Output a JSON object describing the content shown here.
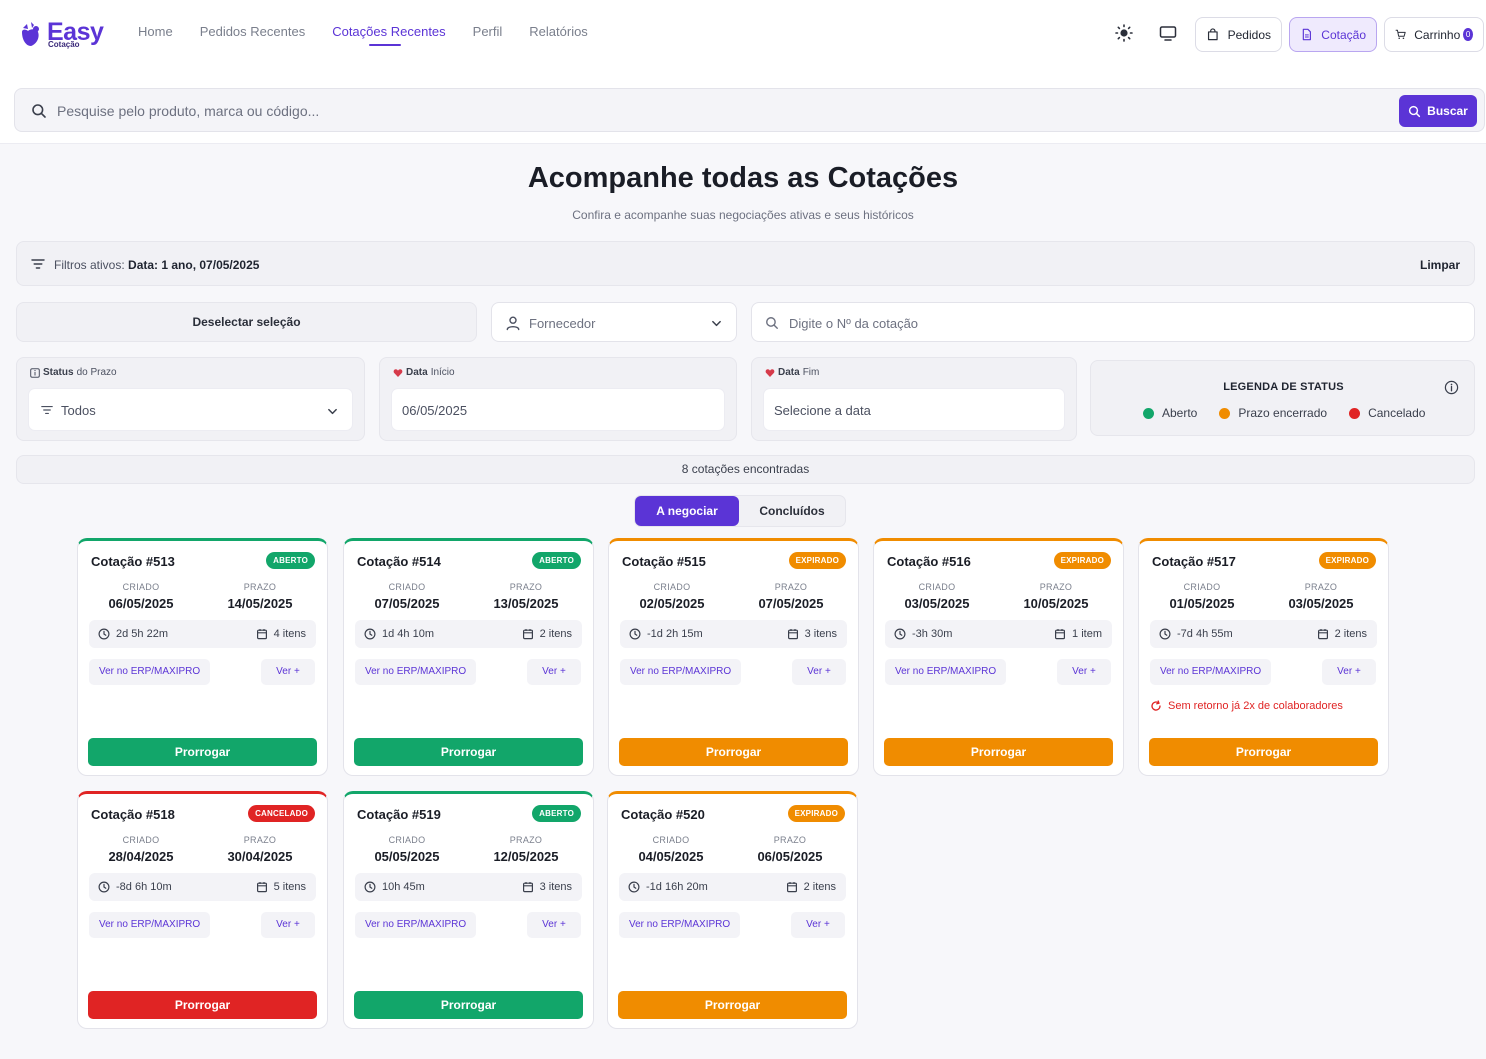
{
  "header": {
    "logo_text": "Easy",
    "logo_sub": "Cotação",
    "nav": [
      "Home",
      "Pedidos Recentes",
      "Cotações Recentes",
      "Perfil",
      "Relatórios"
    ],
    "active_nav": "Cotações Recentes",
    "pedidos_label": "Pedidos",
    "cotacao_label": "Cotação",
    "carrinho_label": "Carrinho",
    "cart_count": "0"
  },
  "search": {
    "placeholder": "Pesquise pelo produto, marca ou código...",
    "button_label": "Buscar"
  },
  "page": {
    "title": "Acompanhe todas as Cotações",
    "subtitle": "Confira e acompanhe suas negociações ativas e seus históricos"
  },
  "filters": {
    "active_prefix": "Filtros ativos:",
    "active_value": "Data: 1 ano, 07/05/2025",
    "clear_label": "Limpar",
    "deselect_label": "Deselectar seleção",
    "supplier_placeholder": "Fornecedor",
    "quote_no_placeholder": "Digite o Nº da cotação",
    "status_label_bold": "Status",
    "status_label_rest": "do Prazo",
    "status_value": "Todos",
    "start_label_bold": "Data",
    "start_label_rest": "Início",
    "start_value": "06/05/2025",
    "end_label_bold": "Data",
    "end_label_rest": "Fim",
    "end_placeholder": "Selecione a data"
  },
  "legend": {
    "title": "LEGENDA DE STATUS",
    "items": [
      {
        "label": "Aberto",
        "color": "#12a66a"
      },
      {
        "label": "Prazo encerrado",
        "color": "#f08c00"
      },
      {
        "label": "Cancelado",
        "color": "#e02424"
      }
    ]
  },
  "results": {
    "count_text": "8 cotações encontradas"
  },
  "tabs": [
    "A negociar",
    "Concluídos"
  ],
  "card_labels": {
    "created": "CRIADO",
    "deadline": "PRAZO",
    "erp_link": "Ver no ERP/MAXIPRO",
    "more": "Ver +",
    "action": "Prorrogar"
  },
  "cards": [
    {
      "title": "Cotação #513",
      "badge": "ABERTO",
      "created": "06/05/2025",
      "deadline": "14/05/2025",
      "time": "2d 5h 22m",
      "items": "4 itens",
      "warning": ""
    },
    {
      "title": "Cotação #514",
      "badge": "ABERTO",
      "created": "07/05/2025",
      "deadline": "13/05/2025",
      "time": "1d 4h 10m",
      "items": "2 itens",
      "warning": ""
    },
    {
      "title": "Cotação #515",
      "badge": "EXPIRADO",
      "created": "02/05/2025",
      "deadline": "07/05/2025",
      "time": "-1d 2h 15m",
      "items": "3 itens",
      "warning": ""
    },
    {
      "title": "Cotação #516",
      "badge": "EXPIRADO",
      "created": "03/05/2025",
      "deadline": "10/05/2025",
      "time": "-3h 30m",
      "items": "1 item",
      "warning": ""
    },
    {
      "title": "Cotação #517",
      "badge": "EXPIRADO",
      "created": "01/05/2025",
      "deadline": "03/05/2025",
      "time": "-7d 4h 55m",
      "items": "2 itens",
      "warning": "Sem retorno já 2x de colaboradores"
    },
    {
      "title": "Cotação #518",
      "badge": "CANCELADO",
      "created": "28/04/2025",
      "deadline": "30/04/2025",
      "time": "-8d 6h 10m",
      "items": "5 itens",
      "warning": ""
    },
    {
      "title": "Cotação #519",
      "badge": "ABERTO",
      "created": "05/05/2025",
      "deadline": "12/05/2025",
      "time": "10h 45m",
      "items": "3 itens",
      "warning": ""
    },
    {
      "title": "Cotação #520",
      "badge": "EXPIRADO",
      "created": "04/05/2025",
      "deadline": "06/05/2025",
      "time": "-1d 16h 20m",
      "items": "2 itens",
      "warning": ""
    }
  ]
}
